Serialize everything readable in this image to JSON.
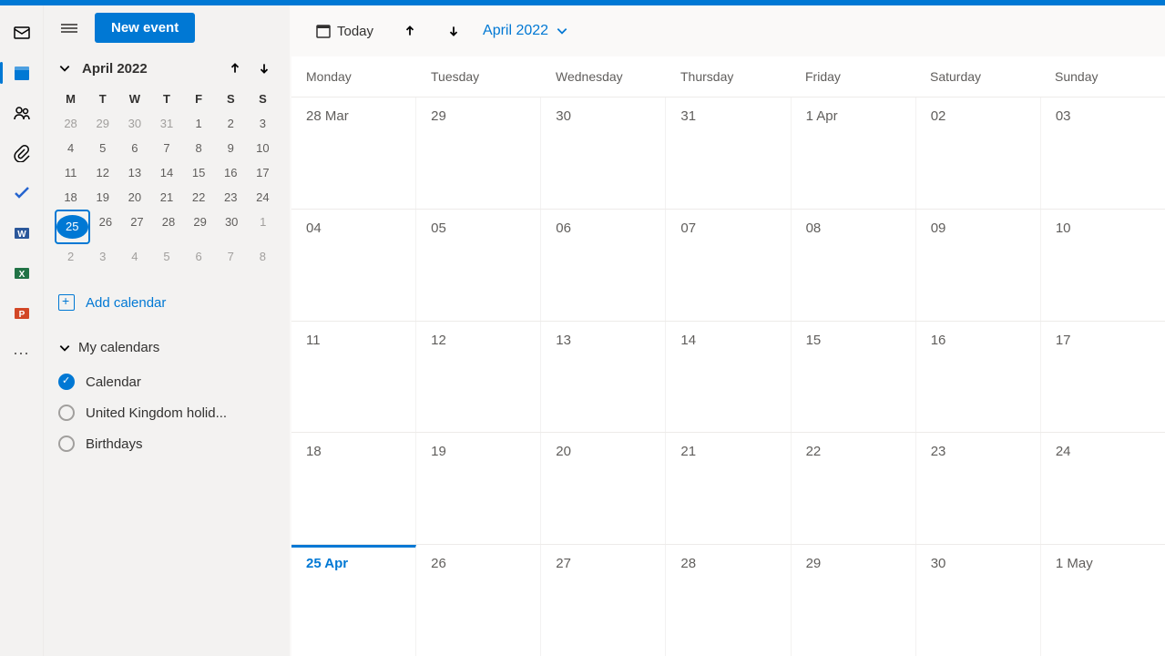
{
  "toolbar": {
    "new_event_label": "New event",
    "today_label": "Today",
    "month_label": "April 2022"
  },
  "mini_calendar": {
    "title": "April 2022",
    "day_headers": [
      "M",
      "T",
      "W",
      "T",
      "F",
      "S",
      "S"
    ],
    "weeks": [
      [
        {
          "d": "28",
          "o": true
        },
        {
          "d": "29",
          "o": true
        },
        {
          "d": "30",
          "o": true
        },
        {
          "d": "31",
          "o": true
        },
        {
          "d": "1"
        },
        {
          "d": "2"
        },
        {
          "d": "3"
        }
      ],
      [
        {
          "d": "4"
        },
        {
          "d": "5"
        },
        {
          "d": "6"
        },
        {
          "d": "7"
        },
        {
          "d": "8"
        },
        {
          "d": "9"
        },
        {
          "d": "10"
        }
      ],
      [
        {
          "d": "11"
        },
        {
          "d": "12"
        },
        {
          "d": "13"
        },
        {
          "d": "14"
        },
        {
          "d": "15"
        },
        {
          "d": "16"
        },
        {
          "d": "17"
        }
      ],
      [
        {
          "d": "18"
        },
        {
          "d": "19"
        },
        {
          "d": "20"
        },
        {
          "d": "21"
        },
        {
          "d": "22"
        },
        {
          "d": "23"
        },
        {
          "d": "24"
        }
      ],
      [
        {
          "d": "25",
          "today": true
        },
        {
          "d": "26"
        },
        {
          "d": "27"
        },
        {
          "d": "28"
        },
        {
          "d": "29"
        },
        {
          "d": "30"
        },
        {
          "d": "1",
          "o": true
        }
      ],
      [
        {
          "d": "2",
          "o": true
        },
        {
          "d": "3",
          "o": true
        },
        {
          "d": "4",
          "o": true
        },
        {
          "d": "5",
          "o": true
        },
        {
          "d": "6",
          "o": true
        },
        {
          "d": "7",
          "o": true
        },
        {
          "d": "8",
          "o": true
        }
      ]
    ]
  },
  "add_calendar_label": "Add calendar",
  "my_calendars": {
    "title": "My calendars",
    "items": [
      {
        "label": "Calendar",
        "checked": true
      },
      {
        "label": "United Kingdom holid...",
        "checked": false
      },
      {
        "label": "Birthdays",
        "checked": false
      }
    ]
  },
  "grid": {
    "headers": [
      "Monday",
      "Tuesday",
      "Wednesday",
      "Thursday",
      "Friday",
      "Saturday",
      "Sunday"
    ],
    "rows": [
      [
        "28 Mar",
        "29",
        "30",
        "31",
        "1 Apr",
        "02",
        "03"
      ],
      [
        "04",
        "05",
        "06",
        "07",
        "08",
        "09",
        "10"
      ],
      [
        "11",
        "12",
        "13",
        "14",
        "15",
        "16",
        "17"
      ],
      [
        "18",
        "19",
        "20",
        "21",
        "22",
        "23",
        "24"
      ],
      [
        "25 Apr",
        "26",
        "27",
        "28",
        "29",
        "30",
        "1 May"
      ]
    ],
    "today_row": 4,
    "today_col": 0
  }
}
